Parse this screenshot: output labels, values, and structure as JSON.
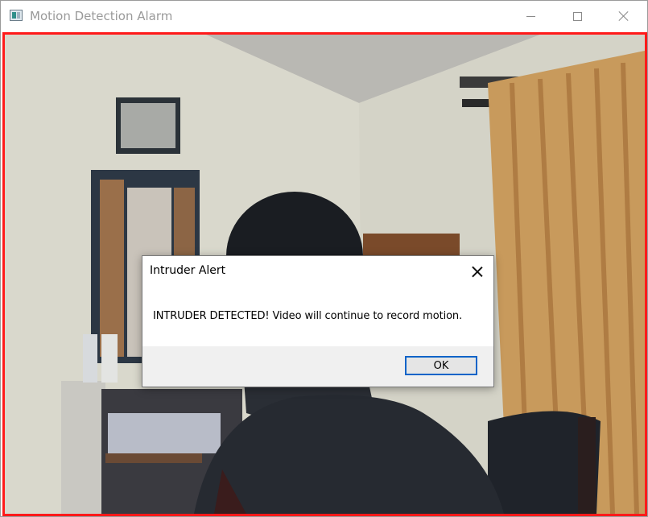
{
  "window": {
    "title": "Motion Detection Alarm",
    "icon": "app-icon",
    "controls": [
      "minimize-icon",
      "maximize-icon",
      "close-icon"
    ]
  },
  "video": {
    "border_color": "#ff1a1a"
  },
  "dialog": {
    "title": "Intruder Alert",
    "message": "INTRUDER DETECTED! Video will continue to record motion.",
    "ok_label": "OK",
    "accent": "#0a64c8"
  }
}
